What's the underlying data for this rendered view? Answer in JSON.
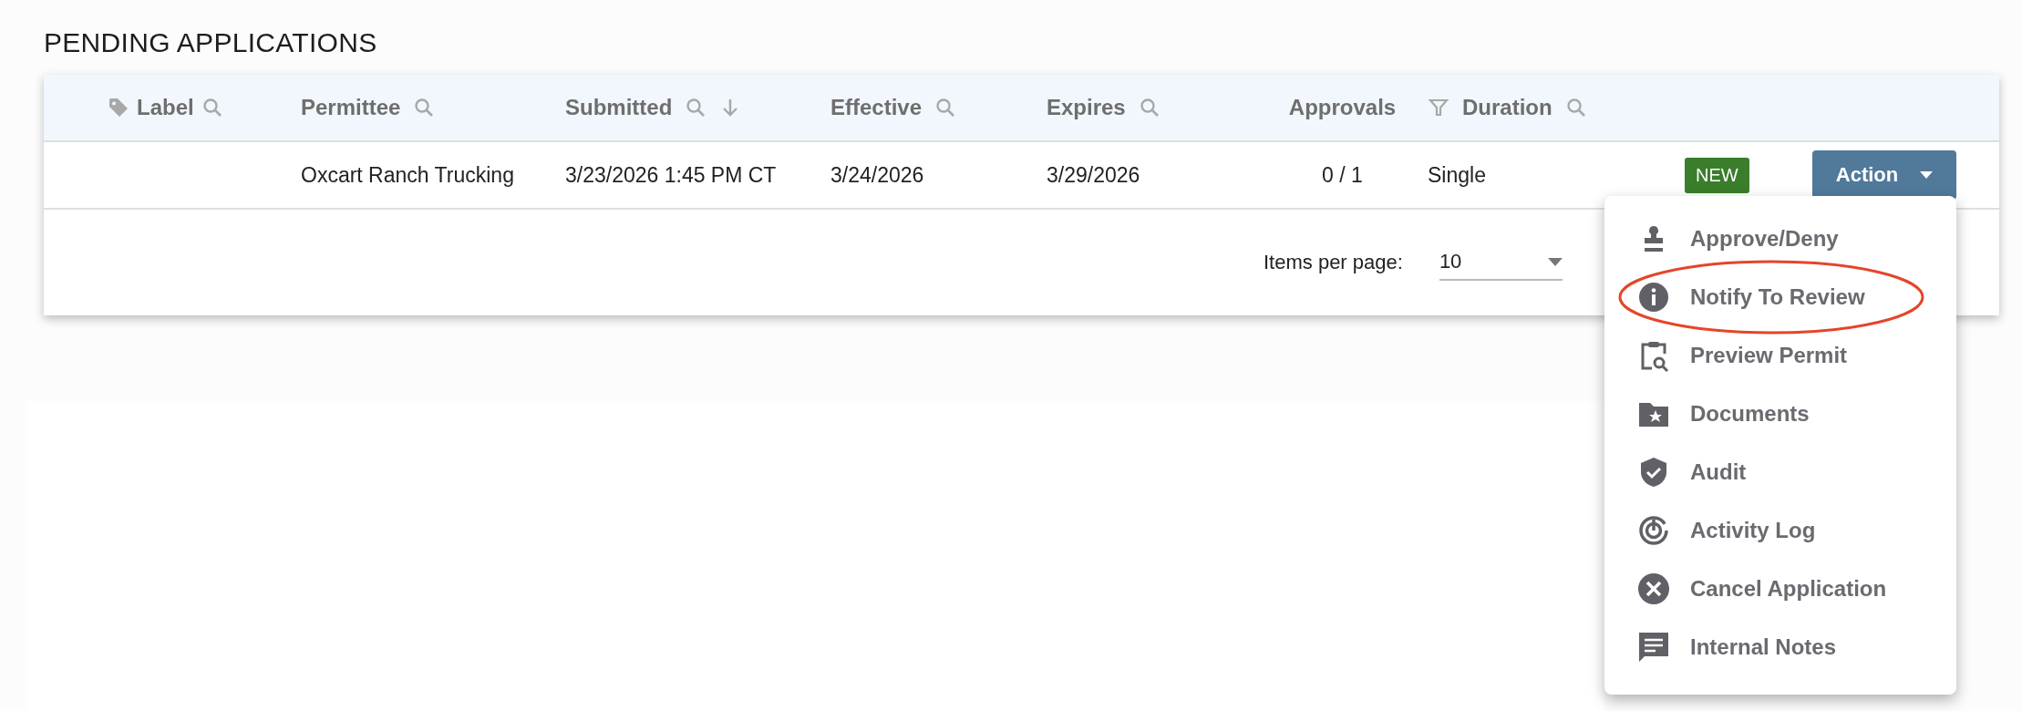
{
  "page_title": "PENDING APPLICATIONS",
  "table": {
    "columns": [
      {
        "label": "Label"
      },
      {
        "label": "Permittee"
      },
      {
        "label": "Submitted"
      },
      {
        "label": "Effective"
      },
      {
        "label": "Expires"
      },
      {
        "label": "Approvals"
      },
      {
        "label": "Duration"
      }
    ],
    "rows": [
      {
        "cells": [
          "",
          "Oxcart Ranch Trucking",
          "3/23/2026 1:45 PM CT",
          "3/24/2026",
          "3/29/2026",
          "0 / 1",
          "Single"
        ],
        "badge": "NEW",
        "action": "Action"
      }
    ],
    "footer": {
      "items_per_page_label": "Items per page:",
      "items_per_page_value": "10"
    }
  },
  "menu": {
    "items": [
      {
        "label": "Approve/Deny",
        "highlighted": false
      },
      {
        "label": "Notify To Review",
        "highlighted": true
      },
      {
        "label": "Preview Permit",
        "highlighted": false
      },
      {
        "label": "Documents",
        "highlighted": false
      },
      {
        "label": "Audit",
        "highlighted": false
      },
      {
        "label": "Activity Log",
        "highlighted": false
      },
      {
        "label": "Cancel Application",
        "highlighted": false
      },
      {
        "label": "Internal Notes",
        "highlighted": false
      }
    ]
  }
}
